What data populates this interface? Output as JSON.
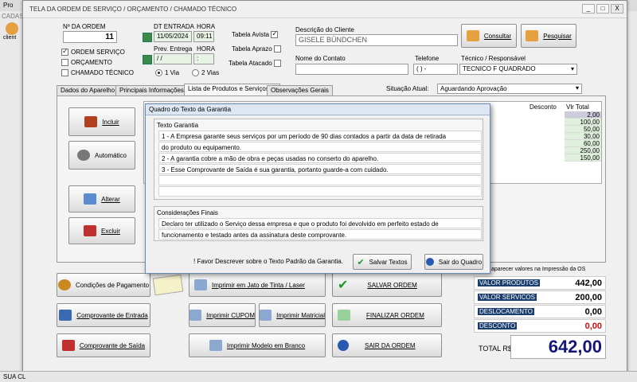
{
  "background_app": {
    "title_fragment": "Pro",
    "menu_fragment": "CADAS",
    "client_fragment": "client",
    "status_fragment": "SUA CL"
  },
  "window": {
    "title": "TELA DA ORDEM DE SERVIÇO / ORÇAMENTO / CHAMADO TÉCNICO",
    "btn_min": "_",
    "btn_max": "□",
    "btn_close": "X"
  },
  "order": {
    "number_label": "Nº DA ORDEM",
    "number_value": "11",
    "type_options": [
      "ORDEM SERVIÇO",
      "ORÇAMENTO",
      "CHAMADO TÉCNICO"
    ],
    "entry_date_label": "DT ENTRADA",
    "entry_time_label": "HORA",
    "entry_date": "11/05/2024",
    "entry_time": "09:11",
    "prev_label": "Prev. Entrega",
    "prev_time_label": "HORA",
    "prev_date": " /  / ",
    "prev_time": "  : ",
    "via_options": [
      "1 Via",
      "2 Vias"
    ]
  },
  "price_tables": [
    "Tabela Avista",
    "Tabela Aprazo",
    "Tabela Atacado"
  ],
  "client": {
    "desc_label": "Descrição do Cliente",
    "desc_value": "GISELE BÜNDCHEN",
    "contact_label": "Nome do Contato",
    "contact_value": "",
    "phone_label": "Telefone",
    "phone_value": "(   )    -",
    "tech_label": "Técnico / Responsável",
    "tech_value": "TECNICO F QUADRADO",
    "consult_button": "Consultar",
    "search_button": "Pesquisar"
  },
  "tabs": [
    "Dados do Aparelho ->",
    "Principais Informações ->",
    "Lista de Produtos e Serviços ->",
    "Observações Gerais"
  ],
  "situation": {
    "label": "Situação Atual:",
    "value": "Aguardando Aprovação"
  },
  "side_buttons": [
    "Incluir",
    "Automático",
    "Alterar",
    "Excluir"
  ],
  "table": {
    "headers": [
      "Desconto",
      "Vlr Total"
    ],
    "totals": [
      "2,00",
      "100,00",
      "50,00",
      "30,00",
      "60,00",
      "250,00",
      "150,00"
    ]
  },
  "dialog": {
    "title": "Quadro do Texto da Garantia",
    "warranty_label": "Texto Garantia",
    "warranty_lines": [
      "1 - A Empresa garante seus serviços por um período de 90 dias contados a partir da data de retirada",
      "do produto ou equipamento.",
      "2 - A garantia cobre a mão de obra e peças usadas no conserto do aparelho.",
      "3 - Esse Comprovante de Saída é sua garantia, portanto guarde-a com cuidado.",
      "",
      ""
    ],
    "final_label": "Considerações Finais",
    "final_lines": [
      "Declaro ter utilizado o Serviço dessa empresa e que o produto foi devolvido em perfeito estado de",
      "funcionamento e testado antes da assinatura deste comprovante."
    ],
    "hint": "! Favor Descrever sobre o Texto Padrão da Garantia.",
    "save_button": "Salvar Textos",
    "exit_button": "Sair do Quadro"
  },
  "bottom_buttons": {
    "payment": "Condições de Pagamento",
    "print_inkjet": "Imprimir em Jato de Tinta / Laser",
    "save_order": "SALVAR ORDEM",
    "entry_receipt": "Comprovante de Entrada",
    "print_coupon": "Imprimir CUPOM",
    "print_matrix": "Imprimir Matricial",
    "finish_order": "FINALIZAR ORDEM",
    "exit_receipt": "Comprovante de Saída",
    "print_blank": "Imprimir Modelo em Branco",
    "exit_order": "SAIR DA ORDEM"
  },
  "totals_panel": {
    "note": "aparecer valores na Impressão da OS",
    "rows": [
      {
        "label": "VALOR PRODUTOS",
        "value": "442,00"
      },
      {
        "label": "VALOR SERVICOS",
        "value": "200,00"
      },
      {
        "label": "DESLOCAMENTO",
        "value": "0,00"
      },
      {
        "label": "DESCONTO",
        "value": "0,00"
      }
    ],
    "total_label": "TOTAL R$",
    "total_value": "642,00"
  },
  "colors": {
    "accent": "#1a3e6e",
    "total_value": "#16167a",
    "discount_value": "#d01010",
    "table_row": "#dff0dc"
  }
}
